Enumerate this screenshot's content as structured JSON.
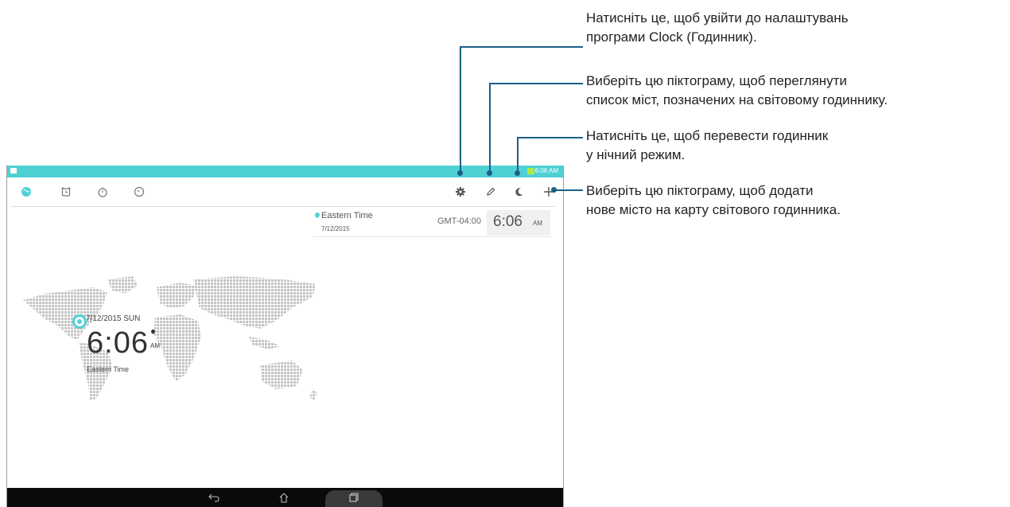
{
  "status_bar": {
    "time": "6:06 AM"
  },
  "toolbar": {
    "tabs": [
      {
        "name": "world-clock",
        "icon": "globe-icon",
        "active": true
      },
      {
        "name": "alarm",
        "icon": "alarm-icon"
      },
      {
        "name": "stopwatch",
        "icon": "stopwatch-icon"
      },
      {
        "name": "timer",
        "icon": "timer-icon"
      }
    ],
    "actions": [
      {
        "name": "settings",
        "icon": "gear-icon"
      },
      {
        "name": "edit",
        "icon": "pencil-icon"
      },
      {
        "name": "night-mode",
        "icon": "moon-icon"
      },
      {
        "name": "add-city",
        "icon": "plus-icon"
      }
    ]
  },
  "city_list": [
    {
      "name": "Eastern Time",
      "date": "7/12/2015",
      "gmt": "GMT-04:00",
      "time": "6:06",
      "ampm": "AM"
    }
  ],
  "map_clock": {
    "date": "7/12/2015 SUN",
    "time": "6:06",
    "ampm": "AM",
    "zone": "Eastern Time"
  },
  "callouts": [
    {
      "line1": "Натисніть це, щоб увійти до налаштувань",
      "line2": "програми Clock (Годинник)."
    },
    {
      "line1": "Виберіть цю піктограму, щоб переглянути",
      "line2": "список міст, позначених на світовому годиннику."
    },
    {
      "line1": "Натисніть це, щоб перевести годинник",
      "line2": "у нічний режим."
    },
    {
      "line1": "Виберіть цю піктограму, щоб додати",
      "line2": "нове місто на карту світового годинника."
    }
  ],
  "colors": {
    "accent": "#4fd1d4",
    "callout": "#1c5f8a",
    "navbar": "#0a0a0a"
  }
}
